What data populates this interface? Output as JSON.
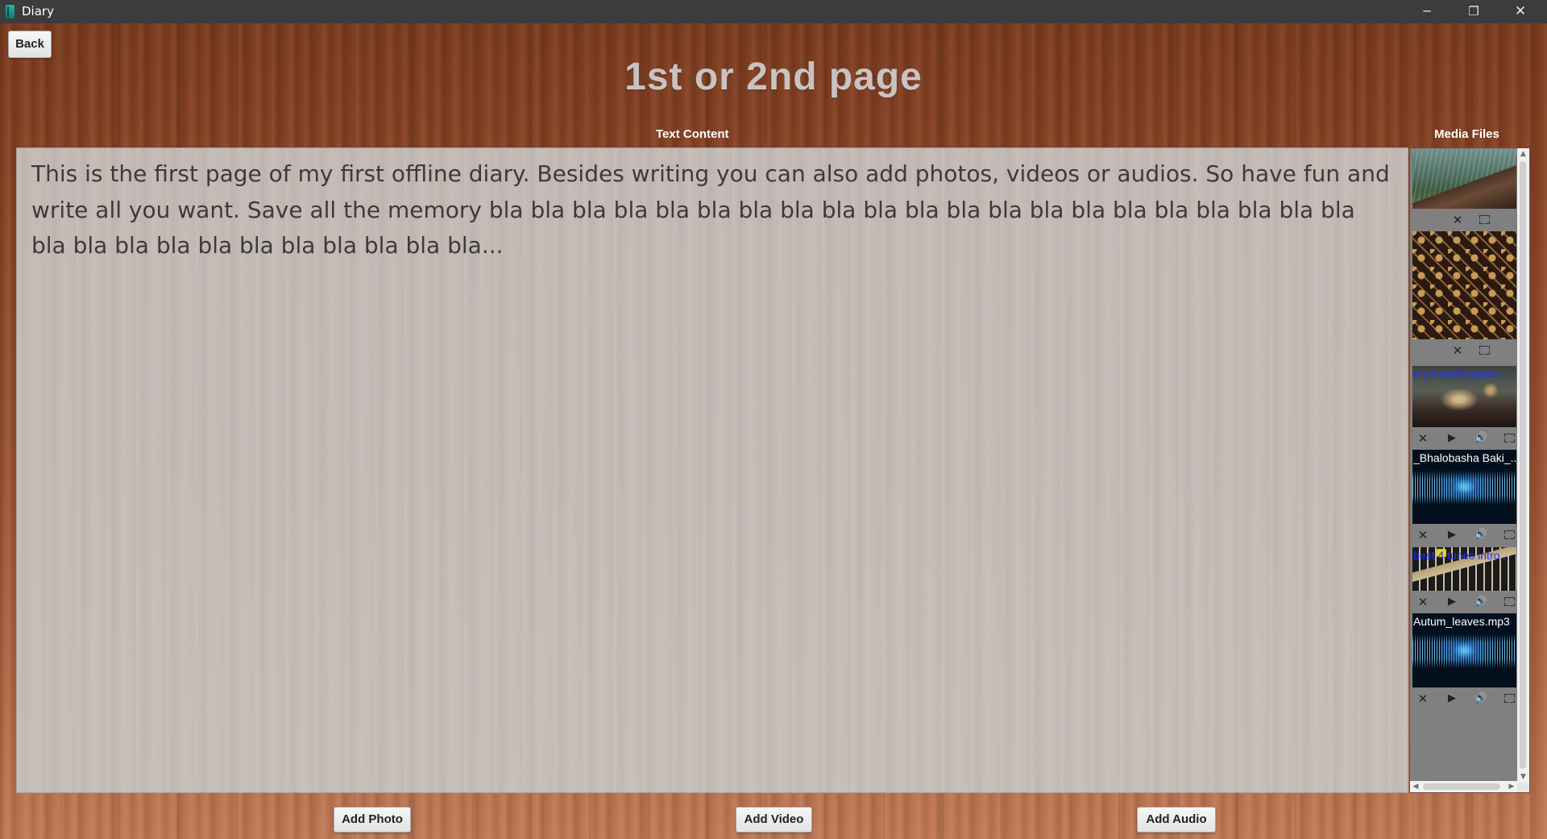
{
  "window": {
    "title": "Diary",
    "minimize_glyph": "─",
    "maximize_glyph": "❐",
    "close_glyph": "✕"
  },
  "toolbar": {
    "back_label": "Back"
  },
  "page": {
    "title": "1st or 2nd page"
  },
  "text_section": {
    "label": "Text Content",
    "content": "This is the first page of my first offline diary. Besides writing you can also add photos, videos or audios. So have fun and write all you want. Save all the memory bla bla bla bla bla bla bla bla bla bla bla bla bla bla bla bla bla bla bla bla bla bla bla bla bla bla bla bla bla bla bla bla..."
  },
  "media_section": {
    "label": "Media Files",
    "items": [
      {
        "kind": "photo",
        "caption": "",
        "image": "rainy-roof-photo",
        "controls": [
          "close-icon",
          "fullscreen-icon"
        ]
      },
      {
        "kind": "photo",
        "caption": "",
        "image": "ornamental-pattern-photo",
        "controls": [
          "close-icon",
          "fullscreen-icon"
        ]
      },
      {
        "kind": "video",
        "caption": "mylivewallpapers...",
        "image": "night-city-video",
        "controls": [
          "close-icon",
          "play-icon",
          "volume-icon",
          "fullscreen-icon"
        ]
      },
      {
        "kind": "audio",
        "caption": "_Bhalobasha Baki_...",
        "image": "sound-wave",
        "controls": [
          "close-icon",
          "play-icon",
          "volume-icon",
          "fullscreen-icon"
        ]
      },
      {
        "kind": "video",
        "caption": "best 4 tunes intro...",
        "image": "guitar-video",
        "controls": [
          "close-icon",
          "play-icon",
          "volume-icon",
          "fullscreen-icon"
        ]
      },
      {
        "kind": "audio",
        "caption": "Autum_leaves.mp3",
        "image": "sound-wave",
        "controls": [
          "close-icon",
          "play-icon",
          "volume-icon",
          "fullscreen-icon"
        ]
      }
    ]
  },
  "bottom_buttons": {
    "add_photo": "Add Photo",
    "add_video": "Add Video",
    "add_audio": "Add Audio"
  },
  "icons": {
    "close": "✕",
    "play": "▶",
    "volume": "🔊"
  },
  "colors": {
    "titlebar": "#3c3c3c",
    "wood_dark": "#7a3a1e",
    "wood_light": "#c17a55",
    "text_area": "#c8c4c1",
    "media_panel": "#808080",
    "caption_link": "#2233ee"
  }
}
